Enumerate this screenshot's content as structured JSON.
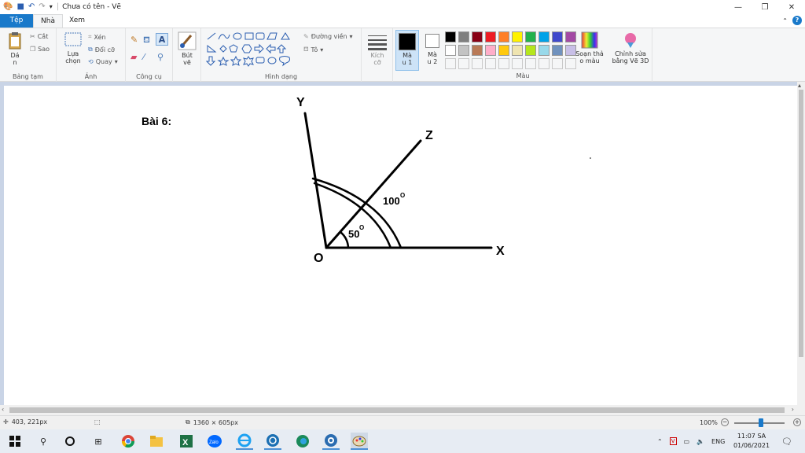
{
  "titlebar": {
    "title": "Chưa có tên - Vẽ"
  },
  "tabs": {
    "file": "Tệp",
    "home": "Nhà",
    "view": "Xem"
  },
  "ribbon": {
    "clipboard": {
      "paste": "Dá\nn",
      "cut": "Cắt",
      "copy": "Sao",
      "label": "Bảng tạm"
    },
    "image": {
      "select": "Lựa\nchọn",
      "crop": "Xén",
      "resize": "Đổi cỡ",
      "rotate": "Quay",
      "label": "Ảnh"
    },
    "tools": {
      "label": "Công cụ"
    },
    "brushes": {
      "label": "Bút\nvẽ"
    },
    "shapes": {
      "outline": "Đường viền",
      "fill": "Tô",
      "label": "Hình dạng"
    },
    "size": {
      "label": "Kích\ncỡ"
    },
    "color1": "Mà\nu 1",
    "color2": "Mà\nu 2",
    "edit_colors": "Soạn thả\no màu",
    "paint3d": "Chỉnh sửa\nbằng Vẽ 3D",
    "colors_label": "Màu",
    "palette_row1": [
      "#000000",
      "#7f7f7f",
      "#880015",
      "#ed1c24",
      "#ff7f27",
      "#fff200",
      "#22b14c",
      "#00a2e8",
      "#3f48cc",
      "#a349a4"
    ],
    "palette_row2": [
      "#ffffff",
      "#c3c3c3",
      "#b97a57",
      "#ffaec9",
      "#ffc90e",
      "#efe4b0",
      "#b5e61d",
      "#99d9ea",
      "#7092be",
      "#c8bfe7"
    ]
  },
  "drawing": {
    "title": "Bài 6:",
    "label_y": "Y",
    "label_z": "Z",
    "label_x": "X",
    "label_o": "O",
    "angle_small": "50",
    "angle_large": "100",
    "degree": "O"
  },
  "statusbar": {
    "cursor_pos": "403, 221px",
    "canvas_size": "1360 × 605px",
    "zoom": "100%"
  },
  "taskbar": {
    "lang": "ENG",
    "time": "11:07 SA",
    "date": "01/06/2021"
  }
}
